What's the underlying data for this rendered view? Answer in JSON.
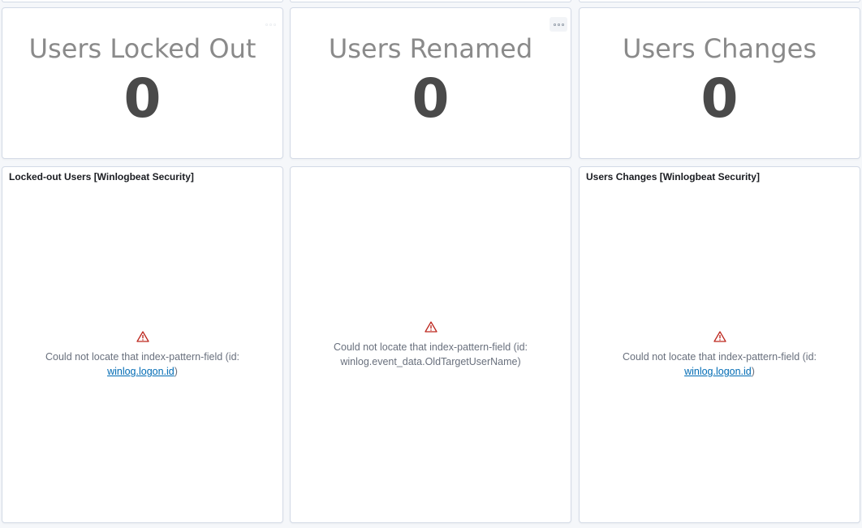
{
  "metrics": [
    {
      "label": "Users Locked Out",
      "value": "0"
    },
    {
      "label": "Users Renamed",
      "value": "0"
    },
    {
      "label": "Users Changes",
      "value": "0"
    }
  ],
  "visualizations": [
    {
      "title": "Locked-out Users [Winlogbeat Security]",
      "error_prefix": "Could not locate that index-pattern-field (id:",
      "error_field": "winlog.logon.id",
      "error_suffix": ")"
    },
    {
      "title": "",
      "error_prefix": "Could not locate that index-pattern-field (id:",
      "error_field": "winlog.event_data.OldTargetUserName)",
      "error_suffix": ""
    },
    {
      "title": "Users Changes [Winlogbeat Security]",
      "error_prefix": "Could not locate that index-pattern-field (id:",
      "error_field": "winlog.logon.id",
      "error_suffix": ")"
    }
  ],
  "icons": {
    "panel_menu": "panel-options-icon",
    "warning": "warning-icon"
  },
  "colors": {
    "warning": "#bd271e",
    "link": "#006bb4",
    "metric_label": "#8a8a8a",
    "metric_value": "#4a4a4a",
    "panel_border": "#d3dae6"
  }
}
